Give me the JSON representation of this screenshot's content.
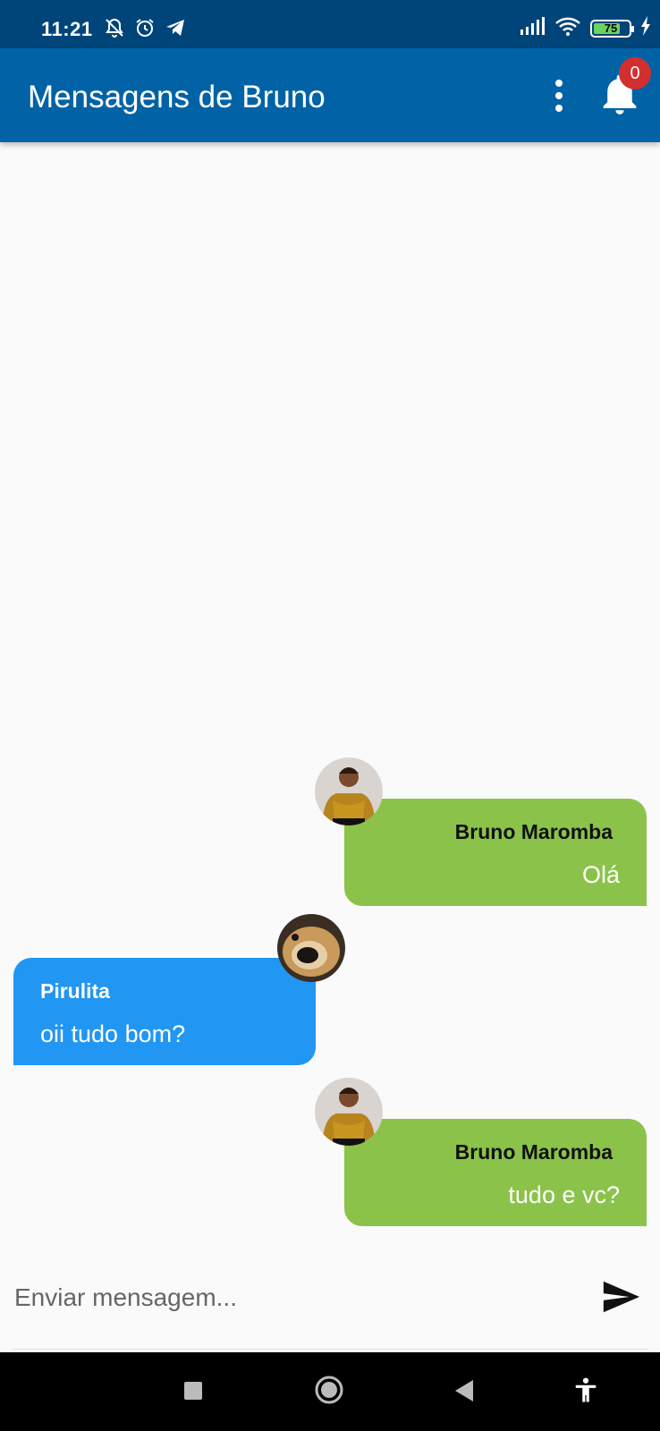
{
  "status_bar": {
    "time": "11:21",
    "icons_left": [
      "notifications-off-icon",
      "alarm-icon",
      "telegram-icon"
    ],
    "icons_right": [
      "signal-icon",
      "wifi-icon",
      "battery-icon",
      "charging-icon"
    ],
    "battery_level": "75"
  },
  "app_bar": {
    "title": "Mensagens de Bruno",
    "menu_icon": "more-vert-icon",
    "notification_icon": "bell-icon",
    "notification_count": "0",
    "background": "#0163a5"
  },
  "messages": [
    {
      "sender": "Bruno Maromba",
      "text": "Olá",
      "side": "right",
      "color": "#8bc34a"
    },
    {
      "sender": "Pirulita",
      "text": "oii tudo bom?",
      "side": "left",
      "color": "#2196f3"
    },
    {
      "sender": "Bruno Maromba",
      "text": "tudo e vc?",
      "side": "right",
      "color": "#8bc34a"
    }
  ],
  "composer": {
    "placeholder": "Enviar mensagem...",
    "value": "",
    "send_icon": "send-icon"
  },
  "nav_bar": {
    "items": [
      "recent-apps-icon",
      "home-icon",
      "back-icon",
      "accessibility-icon"
    ]
  }
}
